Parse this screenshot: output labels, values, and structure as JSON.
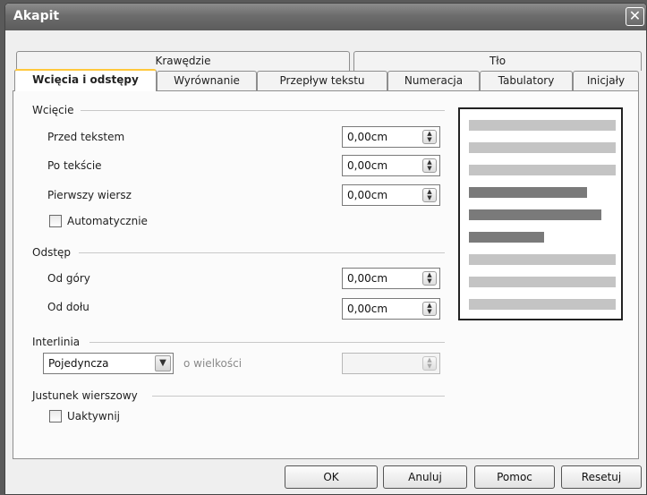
{
  "window": {
    "title": "Akapit"
  },
  "tabs_row1": [
    "Krawędzie",
    "Tło"
  ],
  "tabs_row2": [
    "Wcięcia i odstępy",
    "Wyrównanie",
    "Przepływ tekstu",
    "Numeracja",
    "Tabulatory",
    "Inicjały"
  ],
  "active_tab": "Wcięcia i odstępy",
  "indent": {
    "heading": "Wcięcie",
    "before_label": "Przed tekstem",
    "before_value": "0,00cm",
    "after_label": "Po tekście",
    "after_value": "0,00cm",
    "first_label": "Pierwszy wiersz",
    "first_value": "0,00cm",
    "auto_label": "Automatycznie",
    "auto_checked": false
  },
  "spacing": {
    "heading": "Odstęp",
    "above_label": "Od góry",
    "above_value": "0,00cm",
    "below_label": "Od dołu",
    "below_value": "0,00cm"
  },
  "line_spacing": {
    "heading": "Interlinia",
    "selected": "Pojedyncza",
    "of_label": "o wielkości",
    "of_value": ""
  },
  "register": {
    "heading": "Justunek wierszowy",
    "activate_label": "Uaktywnij",
    "activate_checked": false
  },
  "buttons": {
    "ok": "OK",
    "cancel": "Anuluj",
    "help": "Pomoc",
    "reset": "Resetuj"
  },
  "colors": {
    "titlebar": "#6c6c6c",
    "active_tab_accent": "#ffc83c",
    "preview_light": "#c4c4c4",
    "preview_dark": "#7a7a7a"
  }
}
